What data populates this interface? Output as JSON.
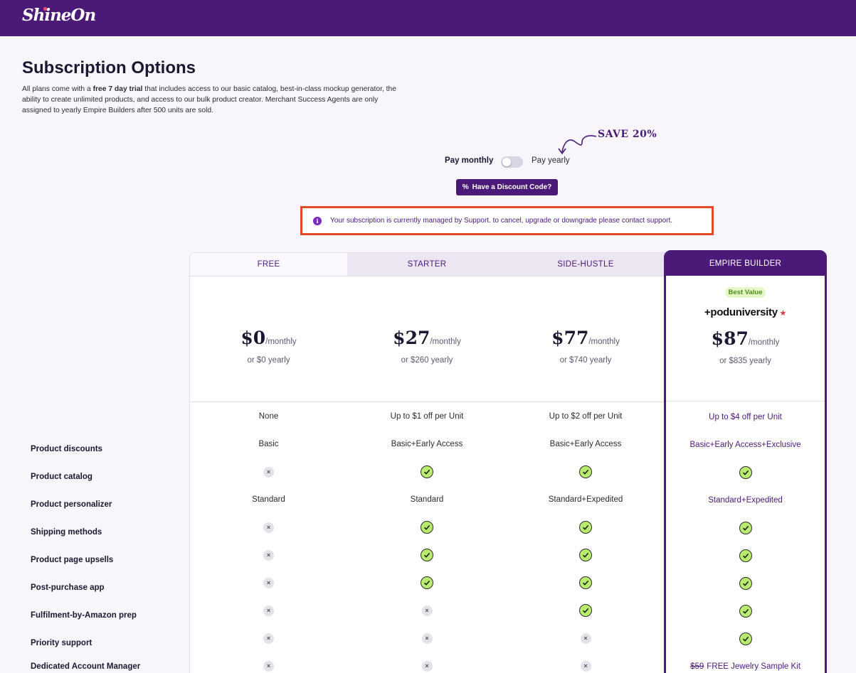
{
  "brand": "ShineOn",
  "title": "Subscription Options",
  "intro": {
    "a": "All plans come with a ",
    "b": "free 7 day trial",
    "c": " that includes access to our basic catalog, best-in-class mockup generator, the ability to create unlimited products, and access to our bulk product creator. Merchant Success Agents are only assigned to yearly Empire Builders after 500 units are sold."
  },
  "billing": {
    "monthly": "Pay monthly",
    "yearly": "Pay yearly",
    "save": "SAVE 20%",
    "selected": "monthly"
  },
  "discount_button": "Have a Discount Code?",
  "notice": "Your subscription is currently managed by Support. to cancel, upgrade or downgrade please contact support.",
  "features": [
    "Product discounts",
    "Product catalog",
    "Product personalizer",
    "Shipping methods",
    "Product page upsells",
    "Post-purchase app",
    "Fulfilment-by-Amazon prep",
    "Priority support",
    "Dedicated Account Manager"
  ],
  "plans": [
    {
      "name": "FREE",
      "price": "$0",
      "per": "/monthly",
      "yearly": "or $0 yearly",
      "cells": [
        {
          "t": "None"
        },
        {
          "t": "Basic"
        },
        {
          "x": 1
        },
        {
          "t": "Standard"
        },
        {
          "x": 1
        },
        {
          "x": 1
        },
        {
          "x": 1
        },
        {
          "x": 1
        },
        {
          "x": 1
        },
        {
          "x": 1
        }
      ]
    },
    {
      "name": "STARTER",
      "price": "$27",
      "per": "/monthly",
      "yearly": "or $260 yearly",
      "cells": [
        {
          "t": "Up to $1 off per Unit"
        },
        {
          "t": "Basic+Early Access"
        },
        {
          "c": 1
        },
        {
          "t": "Standard"
        },
        {
          "c": 1
        },
        {
          "c": 1
        },
        {
          "c": 1
        },
        {
          "x": 1
        },
        {
          "x": 1
        },
        {
          "x": 1
        }
      ]
    },
    {
      "name": "SIDE-HUSTLE",
      "price": "$77",
      "per": "/monthly",
      "yearly": "or $740 yearly",
      "cells": [
        {
          "t": "Up to $2 off per Unit"
        },
        {
          "t": "Basic+Early Access"
        },
        {
          "c": 1
        },
        {
          "t": "Standard+Expedited"
        },
        {
          "c": 1
        },
        {
          "c": 1
        },
        {
          "c": 1
        },
        {
          "c": 1
        },
        {
          "x": 1
        },
        {
          "x": 1
        }
      ]
    },
    {
      "name": "EMPIRE BUILDER",
      "price": "$87",
      "per": "/monthly",
      "yearly": "or $835 yearly",
      "badge": "Best Value",
      "partner": "+poduniversity",
      "cells": [
        {
          "t": "Up to $4 off per Unit"
        },
        {
          "t": "Basic+Early Access+Exclusive"
        },
        {
          "c": 1
        },
        {
          "t": "Standard+Expedited"
        },
        {
          "c": 1
        },
        {
          "c": 1
        },
        {
          "c": 1
        },
        {
          "c": 1
        },
        {
          "c": 1
        },
        {
          "s": "$59",
          "t": "FREE Jewelry Sample Kit"
        }
      ]
    }
  ]
}
